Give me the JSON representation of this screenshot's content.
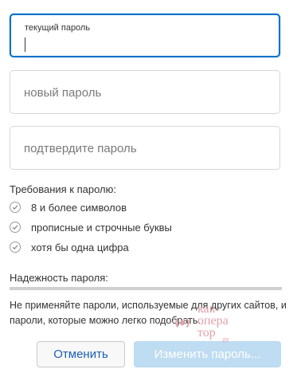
{
  "form": {
    "current_password_label": "текущий пароль",
    "new_password_placeholder": "новый пароль",
    "confirm_password_placeholder": "подтвердите пароль"
  },
  "requirements": {
    "title": "Требования к паролю:",
    "items": [
      "8 и более символов",
      "прописные и строчные буквы",
      "хотя бы одна цифра"
    ]
  },
  "strength": {
    "label": "Надежность пароля:",
    "level": 0
  },
  "note": "Не применяйте пароли, используемые для других сайтов, и пароли, которые можно легко подобрать.",
  "buttons": {
    "cancel_label": "Отменить",
    "change_label": "Изменить пароль..."
  },
  "watermark": {
    "line1": "как",
    "line2": "опера",
    "line3": "тор",
    "suffix": ".ру"
  },
  "colors": {
    "focus": "#0070c9",
    "link_text": "#1a5fb4",
    "disabled_button": "#bedcf2",
    "watermark": "#e2a1a9"
  }
}
